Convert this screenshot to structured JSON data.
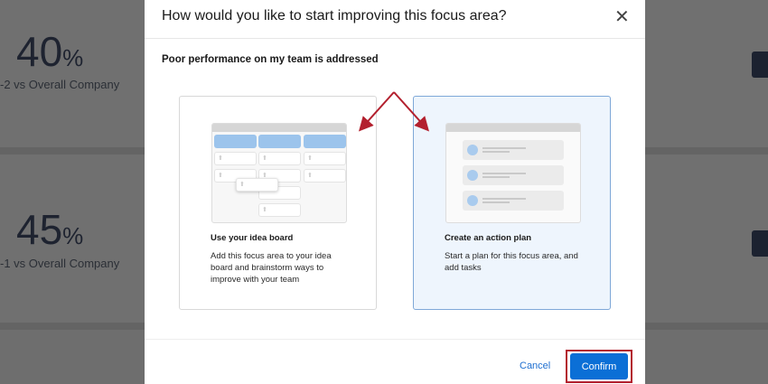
{
  "background": {
    "items": [
      {
        "value": "40",
        "unit": "%",
        "comparison": "-2 vs Overall Company"
      },
      {
        "value": "45",
        "unit": "%",
        "comparison": "-1 vs Overall Company"
      }
    ]
  },
  "dialog": {
    "title": "How would you like to start improving this focus area?",
    "close_icon": "close-icon",
    "subtitle": "Poor performance on my team is addressed",
    "options": [
      {
        "title": "Use your idea board",
        "description": "Add this focus area to your idea board and brainstorm ways to improve with your team",
        "selected": false
      },
      {
        "title": "Create an action plan",
        "description": "Start a plan for this focus area, and add tasks",
        "selected": true
      }
    ],
    "cancel_label": "Cancel",
    "confirm_label": "Confirm"
  },
  "colors": {
    "accent": "#0b6fd6",
    "annotation": "#b3202e",
    "selected_bg": "#eef5fd"
  }
}
